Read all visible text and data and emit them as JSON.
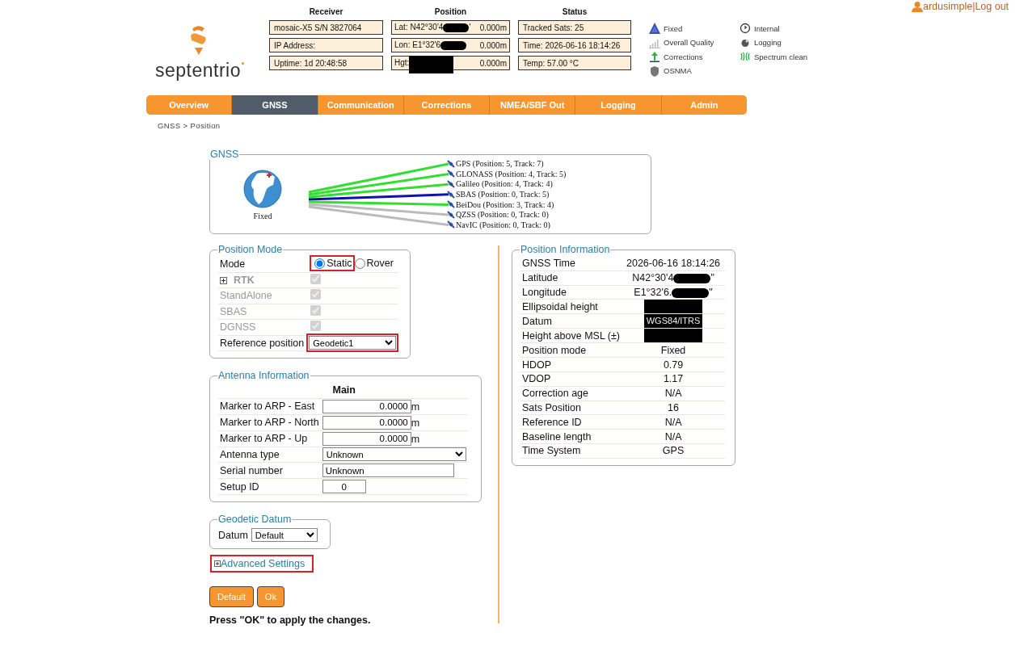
{
  "logo": {
    "text": "septentrio"
  },
  "user": {
    "name": "ardusimple",
    "separator": "|",
    "logout": "Log out"
  },
  "receiver": {
    "heading": "Receiver",
    "cells": [
      {
        "text": "mosaic-X5 S/N 3827064"
      },
      {
        "text": "IP Address:"
      },
      {
        "text": "Uptime: 1d 20:48:58"
      }
    ]
  },
  "position": {
    "heading": "Position",
    "cells": [
      {
        "prefix": "Lat:  N42°30'4",
        "redacted": true,
        "suffix": "'",
        "height": "0.000m"
      },
      {
        "prefix": "Lon: E1°32'6",
        "redacted": true,
        "height": "0.000m"
      },
      {
        "prefix": "Hgt:",
        "redacted": true,
        "height": "0.000m"
      }
    ]
  },
  "status": {
    "heading": "Status",
    "cells": [
      {
        "text": "Tracked Sats: 25"
      },
      {
        "text": "Time: 2026-06-16 18:14:26"
      },
      {
        "text": "Temp: 57.00 °C"
      }
    ]
  },
  "indicators": [
    {
      "kind": "fixed",
      "label": "Fixed"
    },
    {
      "kind": "internal",
      "label": "Internal"
    },
    {
      "kind": "quality",
      "label": "Overall Quality"
    },
    {
      "kind": "logging",
      "label": "Logging"
    },
    {
      "kind": "corrections",
      "label": "Corrections"
    },
    {
      "kind": "spectrum",
      "label": "Spectrum clean"
    },
    {
      "kind": "osnma",
      "label": "OSNMA"
    }
  ],
  "tabs": [
    {
      "label": "Overview",
      "selected": false
    },
    {
      "label": "GNSS",
      "selected": true
    },
    {
      "label": "Communication",
      "selected": false
    },
    {
      "label": "Corrections",
      "selected": false
    },
    {
      "label": "NMEA/SBF Out",
      "selected": false
    },
    {
      "label": "Logging",
      "selected": false
    },
    {
      "label": "Admin",
      "selected": false
    }
  ],
  "breadcrumb": "GNSS > Position",
  "gnss": {
    "legend": "GNSS",
    "status": "Fixed",
    "constellations": [
      {
        "label": "GPS (Position: 5, Track: 7)",
        "color": "#33dd33"
      },
      {
        "label": "GLONASS (Position: 4, Track: 5)",
        "color": "#33dd33"
      },
      {
        "label": "Galileo (Position: 4, Track: 4)",
        "color": "#33dd33"
      },
      {
        "label": "SBAS (Position: 0, Track: 5)",
        "color": "#1010b0"
      },
      {
        "label": "BeiDou (Position: 3, Track: 4)",
        "color": "#33dd33"
      },
      {
        "label": "QZSS (Position: 0, Track: 0)",
        "color": "#bbbbbb"
      },
      {
        "label": "NavIC (Position: 0, Track: 0)",
        "color": "#bbbbbb"
      }
    ]
  },
  "position_mode": {
    "legend": "Position Mode",
    "rows": [
      {
        "kind": "radio",
        "label": "Mode",
        "options": [
          {
            "label": "Static",
            "selected": true,
            "highlighted": true
          },
          {
            "label": "Rover",
            "selected": false,
            "highlighted": false
          }
        ]
      },
      {
        "kind": "check",
        "label": "RTK",
        "expandable": true,
        "checked": true,
        "disabled": true
      },
      {
        "kind": "check",
        "label": "StandAlone",
        "expandable": false,
        "checked": true,
        "disabled": true
      },
      {
        "kind": "check",
        "label": "SBAS",
        "expandable": false,
        "checked": true,
        "disabled": true
      },
      {
        "kind": "check",
        "label": "DGNSS",
        "expandable": false,
        "checked": true,
        "disabled": true
      },
      {
        "kind": "select",
        "label": "Reference position",
        "value": "Geodetic1",
        "highlighted": true
      }
    ]
  },
  "antenna": {
    "legend": "Antenna Information",
    "column_heading": "Main",
    "rows": [
      {
        "kind": "number",
        "label": "Marker to ARP - East",
        "value": "0.0000",
        "unit": "m"
      },
      {
        "kind": "number",
        "label": "Marker to ARP - North",
        "value": "0.0000",
        "unit": "m"
      },
      {
        "kind": "number",
        "label": "Marker to ARP - Up",
        "value": "0.0000",
        "unit": "m"
      },
      {
        "kind": "select",
        "label": "Antenna type",
        "value": "Unknown"
      },
      {
        "kind": "text",
        "label": "Serial number",
        "value": "Unknown"
      },
      {
        "kind": "short",
        "label": "Setup ID",
        "value": "0"
      }
    ]
  },
  "geodetic_datum": {
    "legend": "Geodetic Datum",
    "label": "Datum",
    "value": "Default"
  },
  "advanced": {
    "label": "Advanced Settings",
    "highlighted": true
  },
  "buttons": [
    "Default",
    "Ok"
  ],
  "note": "Press \"OK\" to apply the changes.",
  "position_info": {
    "legend": "Position Information",
    "rows": [
      {
        "label": "GNSS Time",
        "value": "2026-06-16 18:14:26"
      },
      {
        "label": "Latitude",
        "value": "N42°30'4",
        "redacted": true,
        "suffix": "\""
      },
      {
        "label": "Longitude",
        "value": "E1°32'6.",
        "redacted": true,
        "suffix": "\""
      },
      {
        "label": "Ellipsoidal height",
        "redacted": true
      },
      {
        "label": "Datum",
        "value": "WGS84/ITRS",
        "redacted": true
      },
      {
        "label": "Height above MSL (±)",
        "redacted": true
      },
      {
        "label": "Position mode",
        "value": "Fixed"
      },
      {
        "label": "HDOP",
        "value": "0.79"
      },
      {
        "label": "VDOP",
        "value": "1.17"
      },
      {
        "label": "Correction age",
        "value": "N/A"
      },
      {
        "label": "Sats Position",
        "value": "16"
      },
      {
        "label": "Reference ID",
        "value": "N/A"
      },
      {
        "label": "Baseline length",
        "value": "N/A"
      },
      {
        "label": "Time System",
        "value": "GPS"
      }
    ]
  }
}
